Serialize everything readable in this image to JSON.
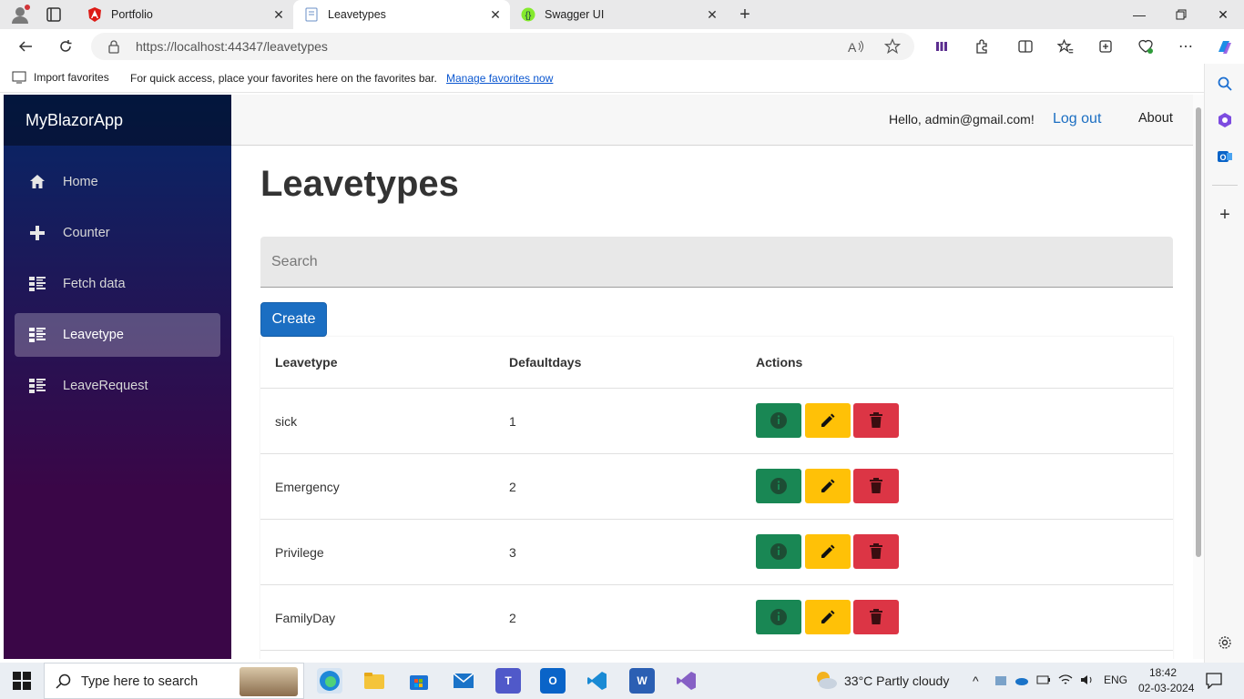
{
  "browser": {
    "tabs": [
      {
        "title": "Portfolio",
        "icon": "angular-icon"
      },
      {
        "title": "Leavetypes",
        "icon": "page-icon"
      },
      {
        "title": "Swagger UI",
        "icon": "swagger-icon"
      }
    ],
    "url": "https://localhost:44347/leavetypes",
    "favorites": {
      "import_label": "Import favorites",
      "message": "For quick access, place your favorites here on the favorites bar.",
      "manage_link": "Manage favorites now"
    }
  },
  "app": {
    "brand": "MyBlazorApp",
    "nav": [
      {
        "label": "Home",
        "icon": "home-icon"
      },
      {
        "label": "Counter",
        "icon": "plus-icon"
      },
      {
        "label": "Fetch data",
        "icon": "list-icon"
      },
      {
        "label": "Leavetype",
        "icon": "list-icon",
        "active": true
      },
      {
        "label": "LeaveRequest",
        "icon": "list-icon"
      }
    ],
    "topbar": {
      "greeting": "Hello, admin@gmail.com!",
      "logout": "Log out",
      "about": "About"
    },
    "page_title": "Leavetypes",
    "search_placeholder": "Search",
    "create_label": "Create",
    "table": {
      "headers": [
        "Leavetype",
        "Defaultdays",
        "Actions"
      ],
      "rows": [
        {
          "leavetype": "sick",
          "defaultdays": "1"
        },
        {
          "leavetype": "Emergency",
          "defaultdays": "2"
        },
        {
          "leavetype": "Privilege",
          "defaultdays": "3"
        },
        {
          "leavetype": "FamilyDay",
          "defaultdays": "2"
        }
      ]
    }
  },
  "colors": {
    "primary": "#1b6ec2",
    "info_btn": "#198754",
    "edit_btn": "#ffc107",
    "delete_btn": "#dc3545",
    "sidebar_top": "#052767",
    "sidebar_bottom": "#3a0647"
  },
  "taskbar": {
    "search_placeholder": "Type here to search",
    "weather": "33°C  Partly cloudy",
    "language": "ENG",
    "time": "18:42",
    "date": "02-03-2024"
  }
}
